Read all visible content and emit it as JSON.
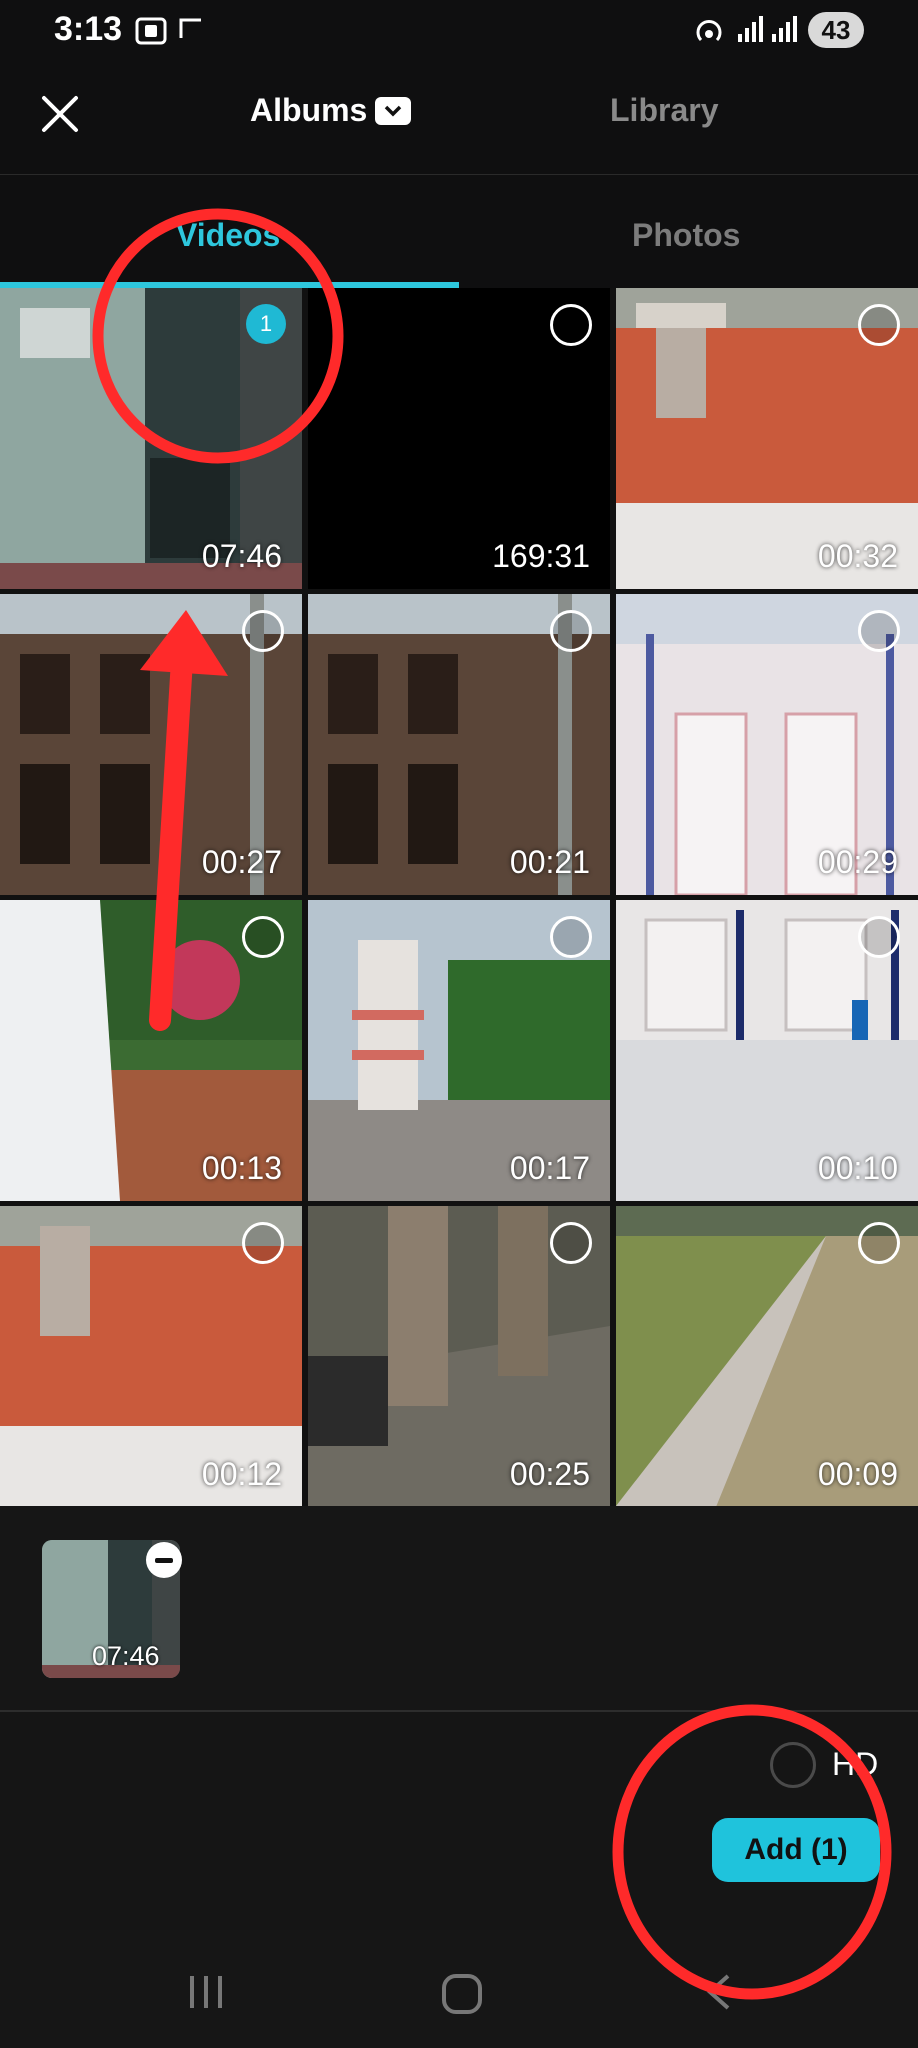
{
  "status_bar": {
    "time": "3:13",
    "battery": "43"
  },
  "header": {
    "albums_label": "Albums",
    "library_label": "Library"
  },
  "tabs": {
    "videos": "Videos",
    "photos": "Photos"
  },
  "grid": {
    "tiles": [
      {
        "duration": "07:46",
        "selected": true,
        "selection_number": "1"
      },
      {
        "duration": "169:31",
        "selected": false
      },
      {
        "duration": "00:32",
        "selected": false
      },
      {
        "duration": "00:27",
        "selected": false
      },
      {
        "duration": "00:21",
        "selected": false
      },
      {
        "duration": "00:29",
        "selected": false
      },
      {
        "duration": "00:13",
        "selected": false
      },
      {
        "duration": "00:17",
        "selected": false
      },
      {
        "duration": "00:10",
        "selected": false
      },
      {
        "duration": "00:12",
        "selected": false
      },
      {
        "duration": "00:25",
        "selected": false
      },
      {
        "duration": "00:09",
        "selected": false
      }
    ]
  },
  "tray": {
    "thumb_duration": "07:46"
  },
  "actions": {
    "hd_label": "HD",
    "add_label": "Add (1)"
  },
  "colors": {
    "accent": "#1fc3dc",
    "annotation_red": "#ff2a2a",
    "background": "#151515"
  },
  "icons": {
    "close": "close-icon",
    "dropdown": "chevron-down-icon",
    "remove": "minus-icon",
    "nav_recent": "recent-apps-icon",
    "nav_home": "home-icon",
    "nav_back": "back-icon"
  }
}
